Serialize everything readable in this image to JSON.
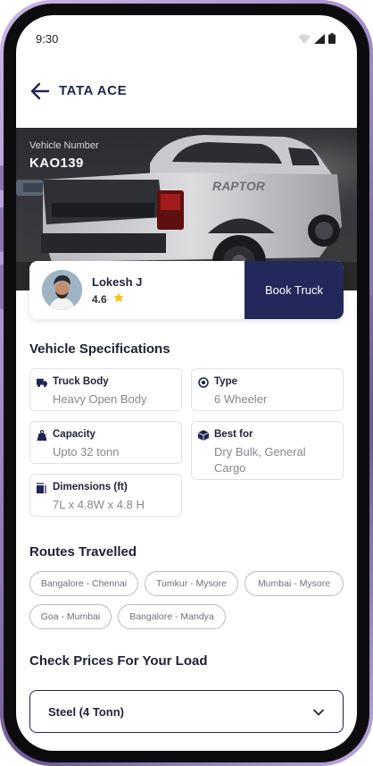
{
  "status_bar": {
    "time": "9:30"
  },
  "header": {
    "title": "TATA ACE"
  },
  "hero": {
    "vehicle_number_label": "Vehicle Number",
    "vehicle_number": "KAO139"
  },
  "driver": {
    "name": "Lokesh J",
    "rating": "4.6",
    "book_label": "Book Truck"
  },
  "specs": {
    "title": "Vehicle Specifications",
    "items": [
      {
        "label": "Truck Body",
        "value": "Heavy Open Body",
        "icon": "truck-icon"
      },
      {
        "label": "Type",
        "value": "6 Wheeler",
        "icon": "wheel-icon"
      },
      {
        "label": "Capacity",
        "value": "Upto 32 tonn",
        "icon": "weight-icon"
      },
      {
        "label": "Best for",
        "value": "Dry Bulk, General Cargo",
        "icon": "box-icon"
      },
      {
        "label": "Dimensions (ft)",
        "value": "7L x 4.8W x 4.8 H",
        "icon": "dimensions-icon"
      }
    ]
  },
  "routes": {
    "title": "Routes Travelled",
    "items": [
      "Bangalore - Chennai",
      "Tumkur - Mysore",
      "Mumbai - Mysore",
      "Goa - Mumbai",
      "Bangalore - Mandya"
    ]
  },
  "prices": {
    "title": "Check Prices For Your Load",
    "selected_load": "Steel (4 Tonn)"
  },
  "colors": {
    "primary": "#22295a",
    "star": "#f5c518",
    "frame": "#a48dc7"
  }
}
